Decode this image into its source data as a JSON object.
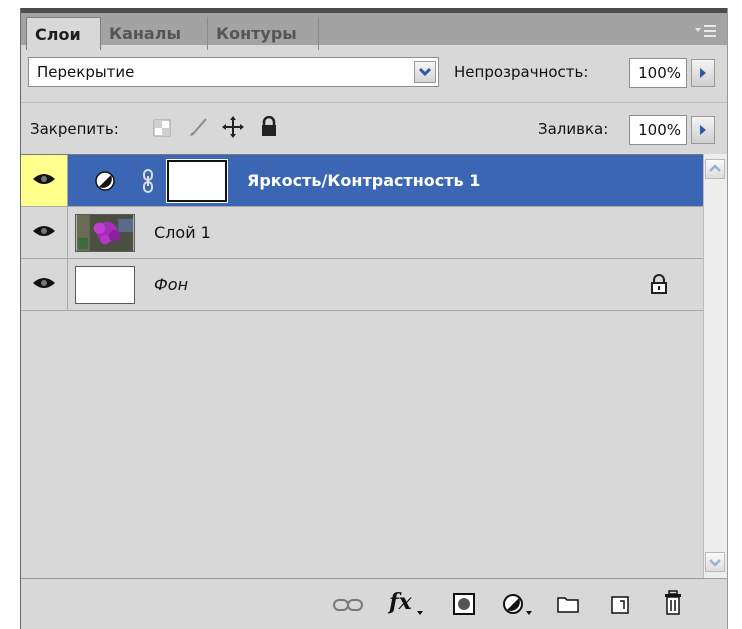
{
  "tabs": [
    {
      "label": "Слои",
      "active": true
    },
    {
      "label": "Каналы",
      "active": false
    },
    {
      "label": "Контуры",
      "active": false
    }
  ],
  "blend_mode": {
    "value": "Перекрытие"
  },
  "opacity": {
    "label": "Непрозрачность:",
    "value": "100%"
  },
  "lock": {
    "label": "Закрепить:"
  },
  "fill": {
    "label": "Заливка:",
    "value": "100%"
  },
  "layers": [
    {
      "name": "Яркость/Контрастность 1",
      "visible": true,
      "selected": true,
      "type": "adjustment"
    },
    {
      "name": "Слой 1",
      "visible": true,
      "selected": false,
      "type": "image"
    },
    {
      "name": "Фон",
      "visible": true,
      "selected": false,
      "type": "background",
      "locked": true
    }
  ],
  "bottom_icons": [
    "link-layers-icon",
    "fx-icon",
    "layer-mask-icon",
    "adjustment-layer-icon",
    "group-icon",
    "new-layer-icon",
    "trash-icon"
  ],
  "colors": {
    "selection": "#3a66b3",
    "panel": "#d8d8d8",
    "eye_highlight": "#ffff8c"
  }
}
